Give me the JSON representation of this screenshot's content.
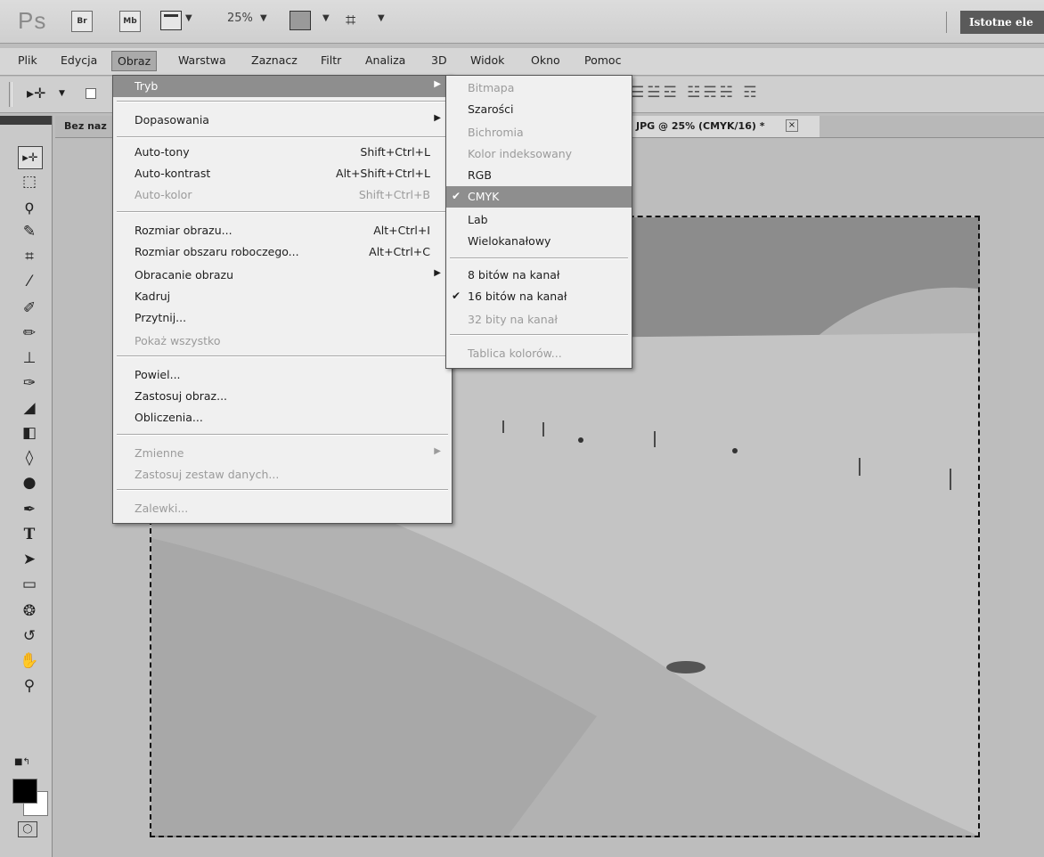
{
  "appbar": {
    "logo": "Ps",
    "bridge_label": "Br",
    "minibridge_label": "Mb",
    "zoom": "25%",
    "workspace": "Istotne ele"
  },
  "menubar": [
    "Plik",
    "Edycja",
    "Obraz",
    "Warstwa",
    "Zaznacz",
    "Filtr",
    "Analiza",
    "3D",
    "Widok",
    "Okno",
    "Pomoc"
  ],
  "doc_tabs": {
    "left_tab": "Bez naz",
    "right_tab": "JPG @ 25% (CMYK/16) *"
  },
  "image_menu": {
    "title_item": "Tryb",
    "items": [
      {
        "label": "Dopasowania",
        "shortcut": "",
        "submenu": true,
        "disabled": false
      },
      {
        "label": "Auto-tony",
        "shortcut": "Shift+Ctrl+L",
        "submenu": false,
        "disabled": false
      },
      {
        "label": "Auto-kontrast",
        "shortcut": "Alt+Shift+Ctrl+L",
        "submenu": false,
        "disabled": false
      },
      {
        "label": "Auto-kolor",
        "shortcut": "Shift+Ctrl+B",
        "submenu": false,
        "disabled": true
      },
      {
        "label": "Rozmiar obrazu...",
        "shortcut": "Alt+Ctrl+I",
        "submenu": false,
        "disabled": false
      },
      {
        "label": "Rozmiar obszaru roboczego...",
        "shortcut": "Alt+Ctrl+C",
        "submenu": false,
        "disabled": false
      },
      {
        "label": "Obracanie obrazu",
        "shortcut": "",
        "submenu": true,
        "disabled": false
      },
      {
        "label": "Kadruj",
        "shortcut": "",
        "submenu": false,
        "disabled": false
      },
      {
        "label": "Przytnij...",
        "shortcut": "",
        "submenu": false,
        "disabled": false
      },
      {
        "label": "Pokaż wszystko",
        "shortcut": "",
        "submenu": false,
        "disabled": true
      },
      {
        "label": "Powiel...",
        "shortcut": "",
        "submenu": false,
        "disabled": false
      },
      {
        "label": "Zastosuj obraz...",
        "shortcut": "",
        "submenu": false,
        "disabled": false
      },
      {
        "label": "Obliczenia...",
        "shortcut": "",
        "submenu": false,
        "disabled": false
      },
      {
        "label": "Zmienne",
        "shortcut": "",
        "submenu": true,
        "disabled": true
      },
      {
        "label": "Zastosuj zestaw danych...",
        "shortcut": "",
        "submenu": false,
        "disabled": true
      },
      {
        "label": "Zalewki...",
        "shortcut": "",
        "submenu": false,
        "disabled": true
      }
    ]
  },
  "mode_menu": {
    "items": [
      {
        "label": "Bitmapa",
        "checked": false,
        "disabled": true
      },
      {
        "label": "Szarości",
        "checked": false,
        "disabled": false
      },
      {
        "label": "Bichromia",
        "checked": false,
        "disabled": true
      },
      {
        "label": "Kolor indeksowany",
        "checked": false,
        "disabled": true
      },
      {
        "label": "RGB",
        "checked": false,
        "disabled": false
      },
      {
        "label": "CMYK",
        "checked": true,
        "disabled": false
      },
      {
        "label": "Lab",
        "checked": false,
        "disabled": false
      },
      {
        "label": "Wielokanałowy",
        "checked": false,
        "disabled": false
      },
      {
        "label": "8 bitów na kanał",
        "checked": false,
        "disabled": false
      },
      {
        "label": "16 bitów na kanał",
        "checked": true,
        "disabled": false
      },
      {
        "label": "32 bity na kanał",
        "checked": false,
        "disabled": true
      },
      {
        "label": "Tablica kolorów...",
        "checked": false,
        "disabled": true
      }
    ]
  },
  "colors": {
    "highlight": "#8e8e8e",
    "menu_bg": "#f0f0f0",
    "foreground_swatch": "#000000",
    "background_swatch": "#ffffff"
  }
}
